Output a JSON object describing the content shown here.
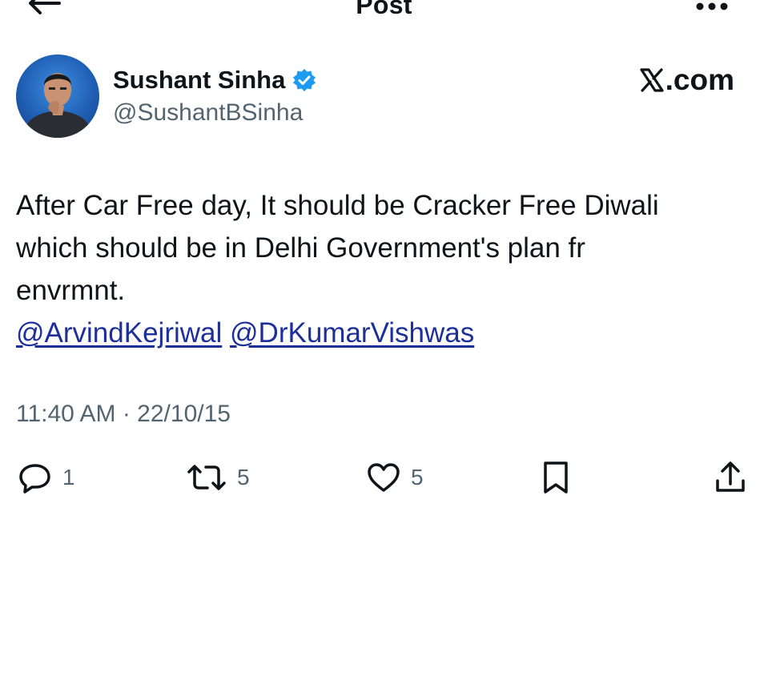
{
  "header": {
    "title": "Post",
    "back_icon": "arrow-left-icon",
    "more_icon": "ellipsis-icon"
  },
  "author": {
    "name": "Sushant Sinha",
    "handle": "@SushantBSinha",
    "verified": true
  },
  "platform_label": ".com",
  "tweet": {
    "lines": [
      "After Car Free day, It should be Cracker Free Diwali",
      "which should be in Delhi Government's plan fr",
      "envrmnt."
    ],
    "mentions": [
      "@ArvindKejriwal",
      "@DrKumarVishwas"
    ]
  },
  "timestamp": "11:40 AM · 22/10/15",
  "actions": {
    "replies": "1",
    "reposts": "5",
    "likes": "5"
  },
  "colors": {
    "text": "#0f1419",
    "secondary": "#536471",
    "mention": "#1d2f9a",
    "verified": "#1d9bf0"
  }
}
